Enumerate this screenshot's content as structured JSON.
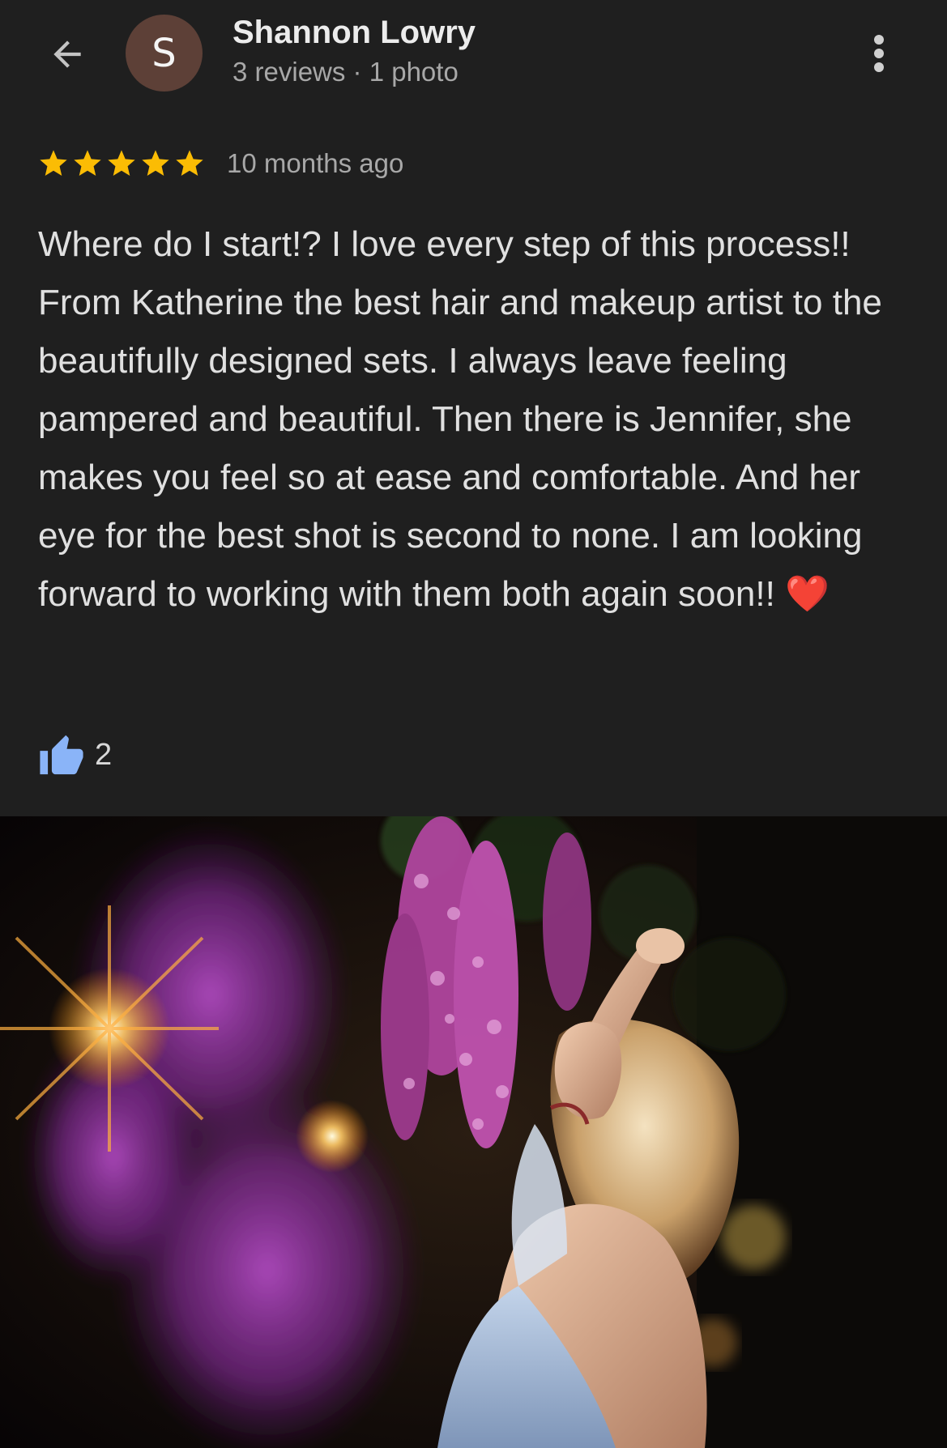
{
  "header": {
    "back_icon": "arrow-back-icon",
    "avatar_letter": "S",
    "avatar_color": "#5d4037",
    "reviewer_name": "Shannon Lowry",
    "reviewer_meta": "3 reviews · 1 photo",
    "more_icon": "more-vert-icon"
  },
  "review": {
    "rating": 5,
    "rating_max": 5,
    "star_color": "#fbbc04",
    "time_ago": "10 months ago",
    "text": "Where do I start!? I love every step of this process!! From Katherine the best hair and makeup artist to the beautifully designed sets. I always leave feeling pampered and beautiful. Then there is Jennifer, she makes you feel so at ease and comfortable. And her eye for the best shot is second to none. I am looking forward to working with them both again soon!! ❤️",
    "likes": "2",
    "like_icon": "thumb-up-icon",
    "like_color": "#8ab4f8"
  },
  "photo": {
    "icon": "review-photo-image"
  }
}
